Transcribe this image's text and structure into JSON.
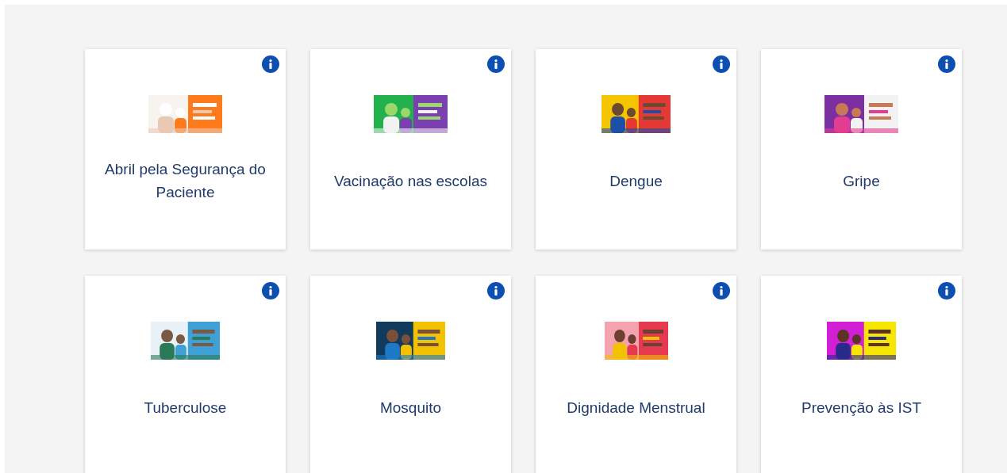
{
  "cards": [
    {
      "title": "Abril pela Segurança do Paciente"
    },
    {
      "title": "Vacinação nas escolas"
    },
    {
      "title": "Dengue"
    },
    {
      "title": "Gripe"
    },
    {
      "title": "Tuberculose"
    },
    {
      "title": "Mosquito"
    },
    {
      "title": "Dignidade Menstrual"
    },
    {
      "title": "Prevenção às IST"
    }
  ]
}
